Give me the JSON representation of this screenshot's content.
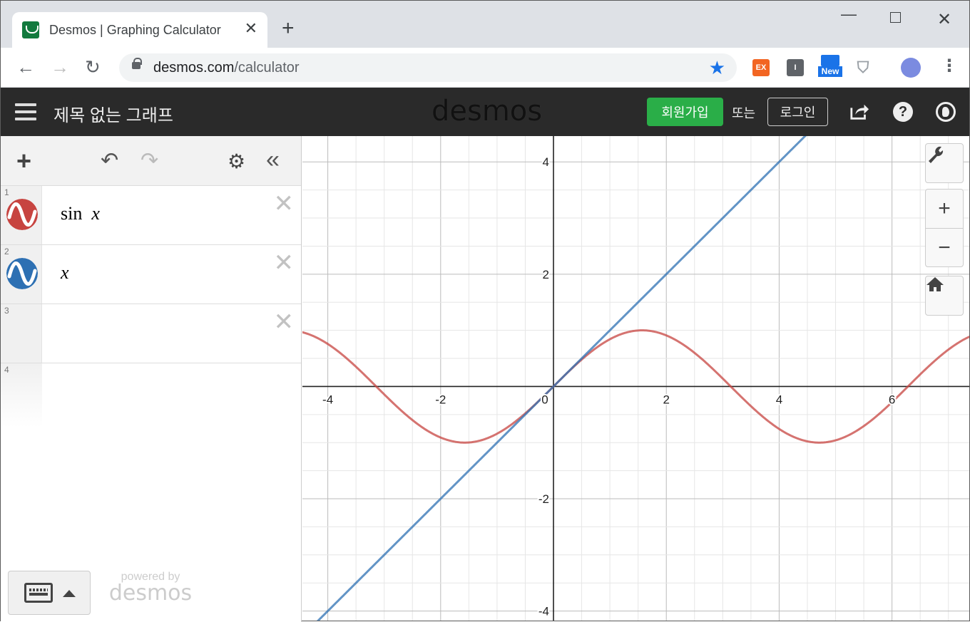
{
  "browser": {
    "tab_title": "Desmos | Graphing Calculator",
    "tab_close": "✕",
    "new_tab": "+",
    "url_host": "desmos.com",
    "url_path": "/calculator",
    "ext_ex_label": "EX",
    "ext_i_label": "I",
    "ext_new_label": "New",
    "window_min": "—",
    "window_close": "✕"
  },
  "desmos": {
    "graph_title": "제목 없는 그래프",
    "logo": "desmos",
    "signup_label": "회원가입",
    "or_label": "또는",
    "login_label": "로그인",
    "help_label": "?"
  },
  "expressions": [
    {
      "index": "1",
      "latex_fn": "sin",
      "latex_var": "x",
      "color": "#c74440"
    },
    {
      "index": "2",
      "latex_fn": "",
      "latex_var": "x",
      "color": "#2d70b3"
    },
    {
      "index": "3",
      "latex_fn": "",
      "latex_var": "",
      "color": ""
    },
    {
      "index": "4",
      "latex_fn": "",
      "latex_var": "",
      "color": ""
    }
  ],
  "footer": {
    "powered_small": "powered by",
    "powered_big": "desmos"
  },
  "chart_data": {
    "type": "line",
    "title": "",
    "xlabel": "",
    "ylabel": "",
    "xlim": [
      -4.45,
      7.37
    ],
    "ylim": [
      -4.17,
      4.46
    ],
    "grid": true,
    "x_ticks": [
      -4,
      -2,
      0,
      2,
      4,
      6
    ],
    "y_ticks": [
      -4,
      -2,
      2,
      4
    ],
    "series": [
      {
        "name": "sin x",
        "function": "sin",
        "color": "#c74440"
      },
      {
        "name": "x",
        "function": "identity",
        "color": "#2d70b3"
      }
    ]
  }
}
